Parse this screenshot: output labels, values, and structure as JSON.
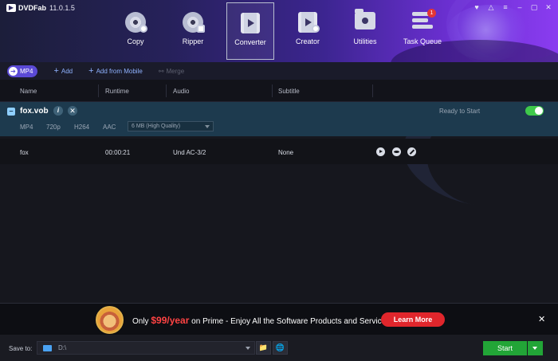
{
  "app": {
    "logo": "DVDFab",
    "version": "11.0.1.5"
  },
  "window_controls": [
    "♥",
    "△",
    "≡",
    "–",
    "▢",
    "✕"
  ],
  "nav": [
    {
      "id": "copy",
      "label": "Copy",
      "icon": "disc-copy-icon"
    },
    {
      "id": "ripper",
      "label": "Ripper",
      "icon": "disc-ripper-icon"
    },
    {
      "id": "converter",
      "label": "Converter",
      "icon": "film-play-icon",
      "active": true
    },
    {
      "id": "creator",
      "label": "Creator",
      "icon": "film-disc-icon"
    },
    {
      "id": "utilities",
      "label": "Utilities",
      "icon": "folder-icon"
    },
    {
      "id": "taskqueue",
      "label": "Task Queue",
      "icon": "list-icon",
      "badge": "1"
    }
  ],
  "toolbar": {
    "format": "MP4",
    "add": "Add",
    "add_from_mobile": "Add from Mobile",
    "merge": "Merge"
  },
  "columns": {
    "name": "Name",
    "runtime": "Runtime",
    "audio": "Audio",
    "subtitle": "Subtitle"
  },
  "file": {
    "name": "fox.vob",
    "status": "Ready to Start",
    "container": "MP4",
    "resolution": "720p",
    "video_codec": "H264",
    "audio_codec": "AAC",
    "quality": "6 MB (High Quality)",
    "title": {
      "name": "fox",
      "runtime": "00:00:21",
      "audio": "Und AC-3/2",
      "subtitle": "None"
    }
  },
  "promo": {
    "prefix": "Only ",
    "price": "$99/year",
    "suffix": " on Prime - Enjoy All the Software Products and Services.",
    "button": "Learn More",
    "close": "✕"
  },
  "footer": {
    "save_label": "Save to:",
    "path": "D:\\",
    "start": "Start"
  },
  "colors": {
    "accent": "#5b4ad6",
    "start_green": "#22a537",
    "learn_more_red": "#e0262c",
    "toggle_green": "#3fc94b"
  }
}
